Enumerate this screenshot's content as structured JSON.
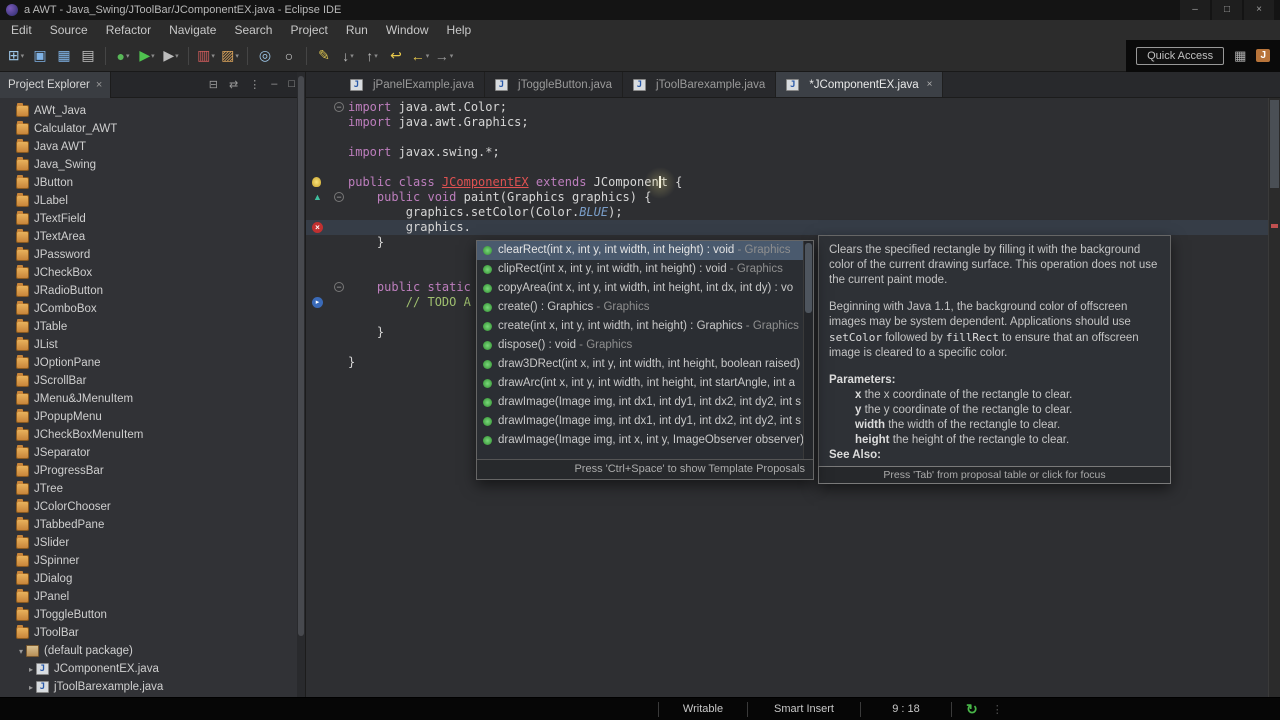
{
  "palette": {
    "keyword": "#bd7ebd",
    "class_error": "#e05252",
    "constant": "#7a9ec9",
    "comment": "#9fbf6f",
    "selection": "#4a5a6e",
    "method_icon": "#3fa33f",
    "error": "#c03030",
    "current_line": "#363d47"
  },
  "titlebar": {
    "title": "a AWT - Java_Swing/JToolBar/JComponentEX.java - Eclipse IDE",
    "controls": [
      {
        "name": "minimize-button",
        "glyph": "–"
      },
      {
        "name": "maximize-button",
        "glyph": "□"
      },
      {
        "name": "close-button",
        "glyph": "×"
      }
    ]
  },
  "menubar": {
    "items": [
      "Edit",
      "Source",
      "Refactor",
      "Navigate",
      "Search",
      "Project",
      "Run",
      "Window",
      "Help"
    ]
  },
  "toolbar": {
    "quick_access_label": "Quick Access",
    "icons": [
      {
        "name": "new-wizard-icon",
        "glyph": "⊞",
        "color": "#9ec7e8",
        "menu": true
      },
      {
        "name": "save-icon",
        "glyph": "▣",
        "color": "#7fb2e5"
      },
      {
        "name": "save-all-icon",
        "glyph": "▦",
        "color": "#7fb2e5"
      },
      {
        "name": "print-icon",
        "glyph": "▤",
        "color": "#c0c0c0"
      },
      {
        "name": "separator"
      },
      {
        "name": "debug-icon",
        "glyph": "●",
        "color": "#58b858",
        "menu": true
      },
      {
        "name": "run-icon",
        "glyph": "▶",
        "color": "#4fc24f",
        "menu": true
      },
      {
        "name": "external-tools-icon",
        "glyph": "▶",
        "color": "#bdbdbd",
        "menu": true
      },
      {
        "name": "separator"
      },
      {
        "name": "coverage-icon",
        "glyph": "▥",
        "color": "#cf5b5b",
        "menu": true
      },
      {
        "name": "new-java-project-icon",
        "glyph": "▨",
        "color": "#d9a25a",
        "menu": true
      },
      {
        "name": "separator"
      },
      {
        "name": "open-type-icon",
        "glyph": "◎",
        "color": "#9ec7e8"
      },
      {
        "name": "search-icon",
        "glyph": "○",
        "color": "#d0d0d0"
      },
      {
        "name": "separator"
      },
      {
        "name": "mark-occurrences-icon",
        "glyph": "✎",
        "color": "#d8c050"
      },
      {
        "name": "next-annotation-icon",
        "glyph": "↓",
        "color": "#b8b8b8",
        "menu": true
      },
      {
        "name": "previous-annotation-icon",
        "glyph": "↑",
        "color": "#b8b8b8",
        "menu": true
      },
      {
        "name": "last-edit-location-icon",
        "glyph": "↩",
        "color": "#e8c84a"
      },
      {
        "name": "back-icon",
        "glyph": "←",
        "color": "#e8c84a",
        "menu": true
      },
      {
        "name": "forward-icon",
        "glyph": "→",
        "color": "#9a9a9a",
        "menu": true
      }
    ]
  },
  "explorer": {
    "title": "Project Explorer",
    "close_glyph": "×",
    "header_icons": [
      {
        "name": "collapse-all-icon",
        "glyph": "⊟"
      },
      {
        "name": "link-with-editor-icon",
        "glyph": "⇄"
      },
      {
        "name": "view-menu-icon",
        "glyph": "⋮"
      },
      {
        "name": "minimize-icon",
        "glyph": "–"
      },
      {
        "name": "maximize-icon",
        "glyph": "□"
      }
    ],
    "items": [
      {
        "label": "AWt_Java",
        "type": "project",
        "indent": 0
      },
      {
        "label": "Calculator_AWT",
        "type": "project",
        "indent": 0
      },
      {
        "label": "Java AWT",
        "type": "project",
        "indent": 0
      },
      {
        "label": "Java_Swing",
        "type": "project",
        "indent": 0
      },
      {
        "label": "JButton",
        "type": "project",
        "indent": 0
      },
      {
        "label": "JLabel",
        "type": "project",
        "indent": 0
      },
      {
        "label": "JTextField",
        "type": "project",
        "indent": 0
      },
      {
        "label": "JTextArea",
        "type": "project",
        "indent": 0
      },
      {
        "label": "JPassword",
        "type": "project",
        "indent": 0
      },
      {
        "label": "JCheckBox",
        "type": "project",
        "indent": 0
      },
      {
        "label": "JRadioButton",
        "type": "project",
        "indent": 0
      },
      {
        "label": "JComboBox",
        "type": "project",
        "indent": 0
      },
      {
        "label": "JTable",
        "type": "project",
        "indent": 0
      },
      {
        "label": "JList",
        "type": "project",
        "indent": 0
      },
      {
        "label": "JOptionPane",
        "type": "project",
        "indent": 0
      },
      {
        "label": "JScrollBar",
        "type": "project",
        "indent": 0
      },
      {
        "label": "JMenu&JMenuItem",
        "type": "project",
        "indent": 0
      },
      {
        "label": "JPopupMenu",
        "type": "project",
        "indent": 0
      },
      {
        "label": "JCheckBoxMenuItem",
        "type": "project",
        "indent": 0
      },
      {
        "label": "JSeparator",
        "type": "project",
        "indent": 0
      },
      {
        "label": "JProgressBar",
        "type": "project",
        "indent": 0
      },
      {
        "label": "JTree",
        "type": "project",
        "indent": 0
      },
      {
        "label": "JColorChooser",
        "type": "project",
        "indent": 0
      },
      {
        "label": "JTabbedPane",
        "type": "project",
        "indent": 0
      },
      {
        "label": "JSlider",
        "type": "project",
        "indent": 0
      },
      {
        "label": "JSpinner",
        "type": "project",
        "indent": 0
      },
      {
        "label": "JDialog",
        "type": "project",
        "indent": 0
      },
      {
        "label": "JPanel",
        "type": "project",
        "indent": 0
      },
      {
        "label": "JToggleButton",
        "type": "project",
        "indent": 0
      },
      {
        "label": "JToolBar",
        "type": "project",
        "indent": 0
      },
      {
        "label": "(default package)",
        "type": "package",
        "indent": 1,
        "chev": "▾"
      },
      {
        "label": "JComponentEX.java",
        "type": "file",
        "indent": 2,
        "chev": "▸"
      },
      {
        "label": "jToolBarexample.java",
        "type": "file",
        "indent": 2,
        "chev": "▸"
      }
    ]
  },
  "tabs": [
    {
      "label": "jPanelExample.java",
      "active": false
    },
    {
      "label": "jToggleButton.java",
      "active": false
    },
    {
      "label": "jToolBarexample.java",
      "active": false
    },
    {
      "label": "*JComponentEX.java",
      "active": true
    }
  ],
  "editor": {
    "lines": [
      {
        "tokens": [
          {
            "t": "kw",
            "s": "import "
          },
          {
            "t": "pl",
            "s": "java.awt.Color;"
          }
        ],
        "fold": true
      },
      {
        "tokens": [
          {
            "t": "kw",
            "s": "import "
          },
          {
            "t": "pl",
            "s": "java.awt.Graphics;"
          }
        ]
      },
      {
        "tokens": []
      },
      {
        "tokens": [
          {
            "t": "kw",
            "s": "import "
          },
          {
            "t": "pl",
            "s": "javax.swing.*;"
          }
        ]
      },
      {
        "tokens": []
      },
      {
        "tokens": [
          {
            "t": "kw",
            "s": "public class "
          },
          {
            "t": "err",
            "s": "JComponentEX"
          },
          {
            "t": "kw",
            "s": " extends "
          },
          {
            "t": "pl",
            "s": "JComponen"
          },
          {
            "t": "caret"
          },
          {
            "t": "pl",
            "s": "t {"
          }
        ],
        "gutter": "bulb"
      },
      {
        "tokens": [
          {
            "t": "pl",
            "s": "    "
          },
          {
            "t": "kw",
            "s": "public void "
          },
          {
            "t": "pl",
            "s": "paint(Graphics graphics) {"
          }
        ],
        "fold": true,
        "gutter": "override"
      },
      {
        "tokens": [
          {
            "t": "pl",
            "s": "        graphics.setColor(Color."
          },
          {
            "t": "const",
            "s": "BLUE"
          },
          {
            "t": "pl",
            "s": ");"
          }
        ]
      },
      {
        "tokens": [
          {
            "t": "pl",
            "s": "        graphics."
          }
        ],
        "gutter": "error",
        "current": true
      },
      {
        "tokens": [
          {
            "t": "pl",
            "s": "    }"
          }
        ]
      },
      {
        "tokens": []
      },
      {
        "tokens": []
      },
      {
        "tokens": [
          {
            "t": "pl",
            "s": "    "
          },
          {
            "t": "kw",
            "s": "public static"
          }
        ],
        "fold": true
      },
      {
        "tokens": [
          {
            "t": "cmt",
            "s": "        // TODO A"
          }
        ],
        "gutter": "marker"
      },
      {
        "tokens": []
      },
      {
        "tokens": [
          {
            "t": "pl",
            "s": "    }"
          }
        ]
      },
      {
        "tokens": []
      },
      {
        "tokens": [
          {
            "t": "pl",
            "s": "}"
          }
        ]
      }
    ]
  },
  "autocomplete": {
    "selected_index": 0,
    "items": [
      {
        "text": "clearRect(int x, int y, int width, int height) : void",
        "origin": "Graphics"
      },
      {
        "text": "clipRect(int x, int y, int width, int height) : void",
        "origin": "Graphics"
      },
      {
        "text": "copyArea(int x, int y, int width, int height, int dx, int dy) : vo"
      },
      {
        "text": "create() : Graphics",
        "origin": "Graphics"
      },
      {
        "text": "create(int x, int y, int width, int height) : Graphics",
        "origin": "Graphics"
      },
      {
        "text": "dispose() : void",
        "origin": "Graphics"
      },
      {
        "text": "draw3DRect(int x, int y, int width, int height, boolean raised)"
      },
      {
        "text": "drawArc(int x, int y, int width, int height, int startAngle, int a"
      },
      {
        "text": "drawImage(Image img, int dx1, int dy1, int dx2, int dy2, int s"
      },
      {
        "text": "drawImage(Image img, int dx1, int dy1, int dx2, int dy2, int s"
      },
      {
        "text": "drawImage(Image img, int x, int y, ImageObserver observer)"
      }
    ],
    "footer": "Press 'Ctrl+Space' to show Template Proposals"
  },
  "javadoc": {
    "para1": "Clears the specified rectangle by filling it with the background color of the current drawing surface. This operation does not use the current paint mode.",
    "para2": [
      {
        "t": "txt",
        "s": "Beginning with Java 1.1, the background color of offscreen images may be system dependent. Applications should use "
      },
      {
        "t": "code",
        "s": "setColor"
      },
      {
        "t": "txt",
        "s": " followed by "
      },
      {
        "t": "code",
        "s": "fillRect"
      },
      {
        "t": "txt",
        "s": " to ensure that an offscreen image is cleared to a specific color."
      }
    ],
    "parameters_label": "Parameters:",
    "parameters": [
      {
        "name": "x",
        "desc": "the x coordinate of the rectangle to clear."
      },
      {
        "name": "y",
        "desc": "the y coordinate of the rectangle to clear."
      },
      {
        "name": "width",
        "desc": "the width of the rectangle to clear."
      },
      {
        "name": "height",
        "desc": "the height of the rectangle to clear."
      }
    ],
    "see_also_label": "See Also:",
    "footer": "Press 'Tab' from proposal table or click for focus"
  },
  "statusbar": {
    "writable": "Writable",
    "smart_insert": "Smart Insert",
    "caret_position": "9 : 18"
  }
}
